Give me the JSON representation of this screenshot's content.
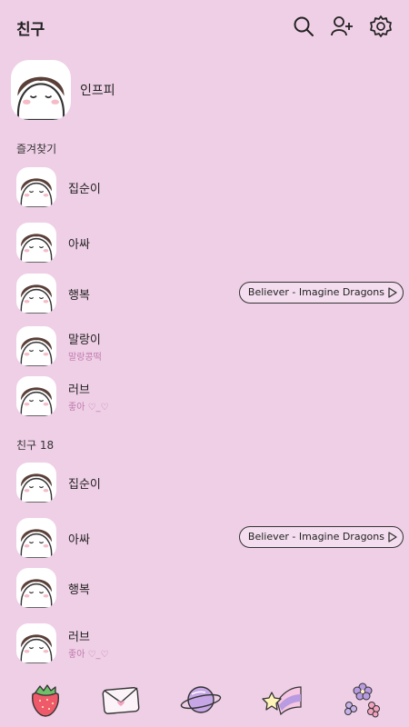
{
  "header": {
    "title": "친구"
  },
  "profile": {
    "name": "인프피"
  },
  "favorites": {
    "label": "즐겨찾기",
    "items": [
      {
        "name": "집순이",
        "status": "",
        "music": ""
      },
      {
        "name": "아싸",
        "status": "",
        "music": ""
      },
      {
        "name": "행복",
        "status": "",
        "music": "Believer - Imagine Dragons"
      },
      {
        "name": "말랑이",
        "status": "말랑콩떡",
        "music": ""
      },
      {
        "name": "러브",
        "status": "좋아 ♡_♡",
        "music": ""
      }
    ]
  },
  "friends": {
    "label": "친구 18",
    "items": [
      {
        "name": "집순이",
        "status": "",
        "music": ""
      },
      {
        "name": "아싸",
        "status": "",
        "music": "Believer - Imagine Dragons"
      },
      {
        "name": "행복",
        "status": "",
        "music": ""
      },
      {
        "name": "러브",
        "status": "좋아 ♡_♡",
        "music": ""
      }
    ]
  },
  "icons": {
    "search": "search-icon",
    "add_friend": "add-friend-icon",
    "settings": "gear-icon",
    "tabs": [
      "strawberry-icon",
      "envelope-icon",
      "planet-icon",
      "shooting-star-icon",
      "flowers-icon"
    ]
  },
  "colors": {
    "background": "#efcfe6",
    "status_text": "#c07aae"
  }
}
